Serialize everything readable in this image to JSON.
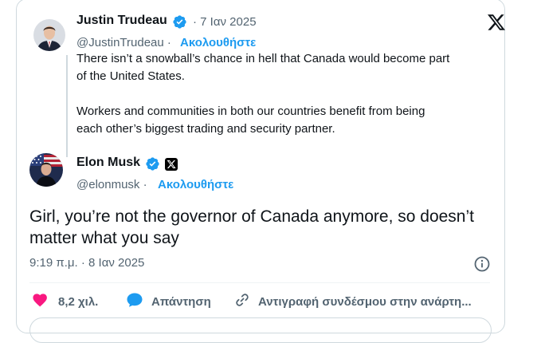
{
  "quoted_tweet": {
    "author_name": "Justin Trudeau",
    "date": "· 7 Ιαν 2025",
    "handle": "@JustinTrudeau ·",
    "follow_label": "Ακολουθήστε",
    "text": "There isn’t a snowball’s chance in hell that Canada would become part\nof the United States.\n\nWorkers and communities in both our countries benefit from being\neach other’s biggest trading and security partner."
  },
  "reply_tweet": {
    "author_name": "Elon Musk",
    "handle": "@elonmusk ·",
    "follow_label": "Ακολουθήστε",
    "text": "Girl, you’re not the governor of Canada anymore, so doesn’t matter what you say",
    "timestamp": "9:19 π.μ. · 8 Ιαν 2025"
  },
  "actions": {
    "likes": "8,2 χιλ.",
    "reply": "Απάντηση",
    "copy_link": "Αντιγραφή συνδέσμου στην ανάρτη..."
  },
  "colors": {
    "accent_blue": "#1d9bf0",
    "like_pink": "#f91880",
    "text": "#0f1419",
    "muted": "#536471",
    "border": "#cfd9de"
  },
  "icons": [
    "x-logo-icon",
    "verified-badge-icon",
    "x-affiliate-badge-icon",
    "info-icon",
    "heart-icon",
    "reply-bubble-icon",
    "link-icon"
  ]
}
